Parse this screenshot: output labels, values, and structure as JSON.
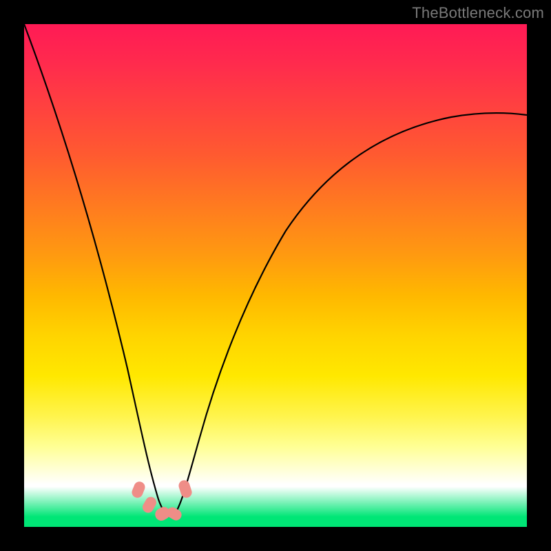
{
  "watermark": "TheBottleneck.com",
  "chart_data": {
    "type": "line",
    "title": "",
    "xlabel": "",
    "ylabel": "",
    "xlim": [
      0,
      100
    ],
    "ylim": [
      0,
      100
    ],
    "grid": false,
    "legend": false,
    "background": "rainbow-gradient-red-to-green",
    "series": [
      {
        "name": "bottleneck-curve",
        "x": [
          0,
          4,
          8,
          12,
          16,
          20,
          23,
          25,
          27,
          29,
          31,
          34,
          38,
          44,
          52,
          62,
          74,
          88,
          100
        ],
        "y": [
          100,
          80,
          62,
          46,
          32,
          18,
          10,
          6,
          3,
          3,
          6,
          12,
          24,
          40,
          55,
          67,
          75,
          79,
          81
        ]
      }
    ],
    "markers": [
      {
        "x": 22.5,
        "y": 8
      },
      {
        "x": 24.5,
        "y": 5
      },
      {
        "x": 26.5,
        "y": 3
      },
      {
        "x": 29.0,
        "y": 3
      },
      {
        "x": 31.5,
        "y": 8
      }
    ]
  }
}
